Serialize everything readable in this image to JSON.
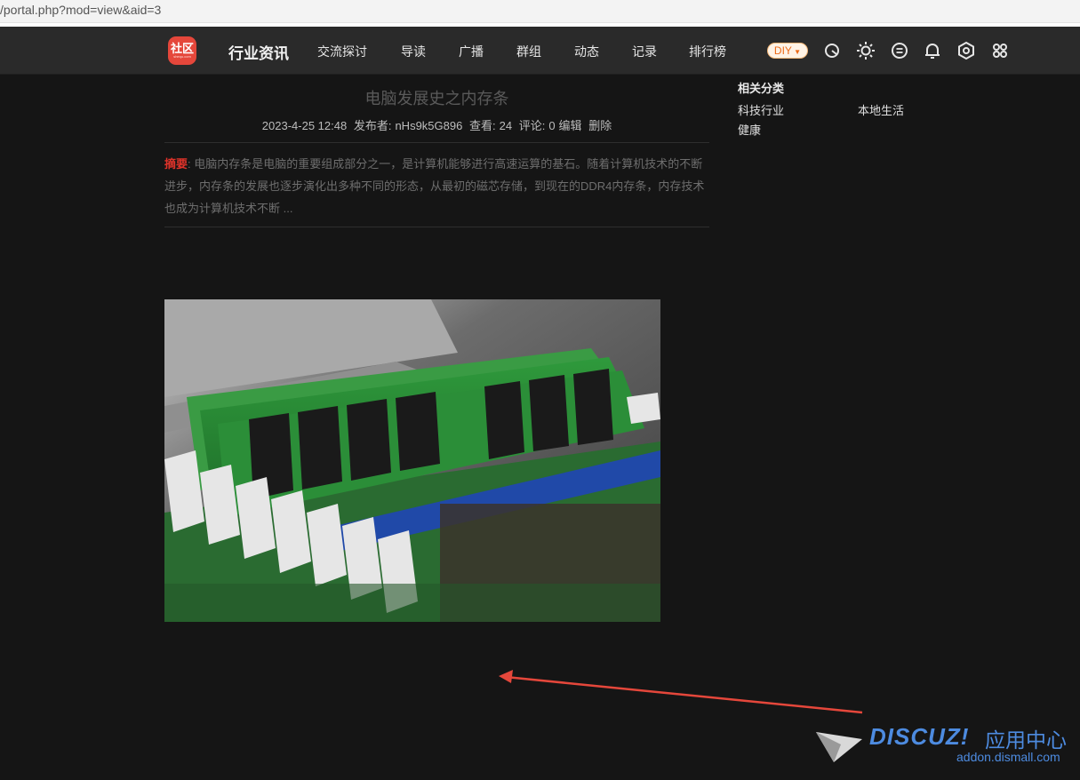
{
  "browser": {
    "url": "/portal.php?mod=view&aid=3"
  },
  "header": {
    "logo_text": "社区",
    "logo_sub": "shequ.com",
    "site_title": "行业资讯",
    "nav": [
      "交流探讨",
      "导读",
      "广播",
      "群组",
      "动态",
      "记录",
      "排行榜"
    ],
    "diy_label": "DIY",
    "icons": [
      "search-icon",
      "theme-icon",
      "message-icon",
      "bell-icon",
      "settings-icon",
      "apps-icon"
    ]
  },
  "article": {
    "title": "电脑发展史之内存条",
    "date": "2023-4-25 12:48",
    "author_label": "发布者:",
    "author": "nHs9k5G896",
    "views_label": "查看:",
    "views": "24",
    "comments_label": "评论:",
    "comments": "0",
    "edit": "编辑",
    "delete": "删除",
    "summary_label": "摘要",
    "summary": ": 电脑内存条是电脑的重要组成部分之一，是计算机能够进行高速运算的基石。随着计算机技术的不断进步，内存条的发展也逐步演化出多种不同的形态，从最初的磁芯存储，到现在的DDR4内存条，内存技术也成为计算机技术不断 ..."
  },
  "sidebar": {
    "title": "相关分类",
    "links": [
      "科技行业",
      "本地生活",
      "健康"
    ]
  },
  "watermark": {
    "brand": "DISCUZ!",
    "cn": "应用中心",
    "url": "addon.dismall.com"
  },
  "colors": {
    "background": "#151515",
    "nav_bg": "#2a2a2a",
    "logo": "#e5473b",
    "summary_label": "#e0332a",
    "arrow": "#e5473b",
    "watermark": "#4d8be0"
  }
}
